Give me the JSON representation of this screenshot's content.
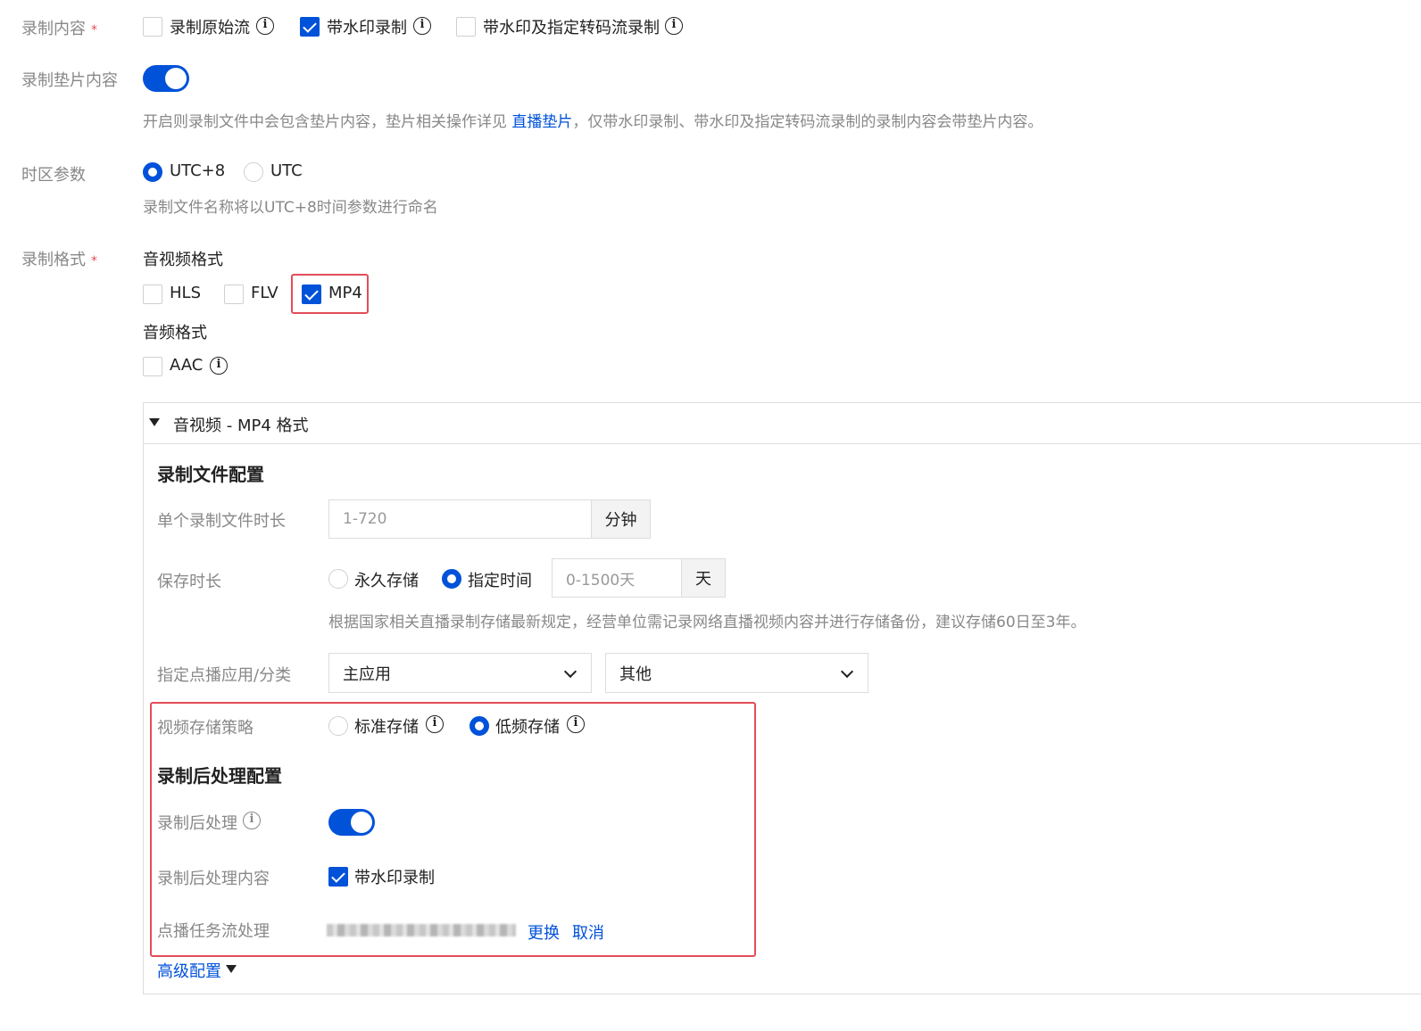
{
  "record_content": {
    "label": "录制内容",
    "required_mark": "*",
    "options": [
      {
        "label": "录制原始流",
        "checked": false
      },
      {
        "label": "带水印录制",
        "checked": true
      },
      {
        "label": "带水印及指定转码流录制",
        "checked": false
      }
    ]
  },
  "slate": {
    "label": "录制垫片内容",
    "enabled": true,
    "hint_prefix": "开启则录制文件中会包含垫片内容，垫片相关操作详见",
    "hint_link": "直播垫片",
    "hint_suffix": "，仅带水印录制、带水印及指定转码流录制的录制内容会带垫片内容。"
  },
  "timezone": {
    "label": "时区参数",
    "options": [
      {
        "label": "UTC+8",
        "selected": true
      },
      {
        "label": "UTC",
        "selected": false
      }
    ],
    "hint": "录制文件名称将以UTC+8时间参数进行命名"
  },
  "format": {
    "label": "录制格式",
    "required_mark": "*",
    "av_title": "音视频格式",
    "av_options": [
      {
        "label": "HLS",
        "checked": false
      },
      {
        "label": "FLV",
        "checked": false
      },
      {
        "label": "MP4",
        "checked": true
      }
    ],
    "audio_title": "音频格式",
    "audio_options": [
      {
        "label": "AAC",
        "checked": false
      }
    ]
  },
  "panel": {
    "title": "音视频 - MP4 格式",
    "file_config_title": "录制文件配置",
    "duration": {
      "label": "单个录制文件时长",
      "placeholder": "1-720",
      "unit": "分钟"
    },
    "retention": {
      "label": "保存时长",
      "options": [
        {
          "label": "永久存储",
          "selected": false
        },
        {
          "label": "指定时间",
          "selected": true
        }
      ],
      "placeholder": "0-1500天",
      "unit": "天",
      "hint": "根据国家相关直播录制存储最新规定，经营单位需记录网络直播视频内容并进行存储备份，建议存储60日至3年。"
    },
    "vod_app": {
      "label": "指定点播应用/分类",
      "app": "主应用",
      "category": "其他"
    },
    "storage_policy": {
      "label": "视频存储策略",
      "options": [
        {
          "label": "标准存储",
          "selected": false
        },
        {
          "label": "低频存储",
          "selected": true
        }
      ]
    },
    "post_title": "录制后处理配置",
    "post_process": {
      "label": "录制后处理",
      "enabled": true
    },
    "post_content": {
      "label": "录制后处理内容",
      "option": "带水印录制",
      "checked": true
    },
    "vod_task": {
      "label": "点播任务流处理",
      "change": "更换",
      "cancel": "取消"
    },
    "advanced": "高级配置"
  },
  "colors": {
    "accent": "#0052d9",
    "highlight": "#e34d59",
    "label": "#888888"
  }
}
